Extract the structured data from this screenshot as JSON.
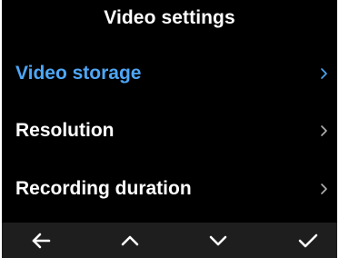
{
  "header": {
    "title": "Video settings"
  },
  "menu": {
    "items": [
      {
        "label": "Video storage",
        "selected": true,
        "icon": "chevron-right-icon"
      },
      {
        "label": "Resolution",
        "selected": false,
        "icon": "chevron-right-icon"
      },
      {
        "label": "Recording duration",
        "selected": false,
        "icon": "chevron-right-icon"
      }
    ]
  },
  "bottom_bar": {
    "buttons": [
      {
        "icon": "arrow-left-icon",
        "action": "back"
      },
      {
        "icon": "chevron-up-icon",
        "action": "up"
      },
      {
        "icon": "chevron-down-icon",
        "action": "down"
      },
      {
        "icon": "checkmark-icon",
        "action": "confirm"
      }
    ]
  },
  "colors": {
    "background": "#000000",
    "text": "#ffffff",
    "accent": "#4ea6f5",
    "chevron": "#b0b0b0",
    "bottom_bar": "#1e1e1e"
  }
}
